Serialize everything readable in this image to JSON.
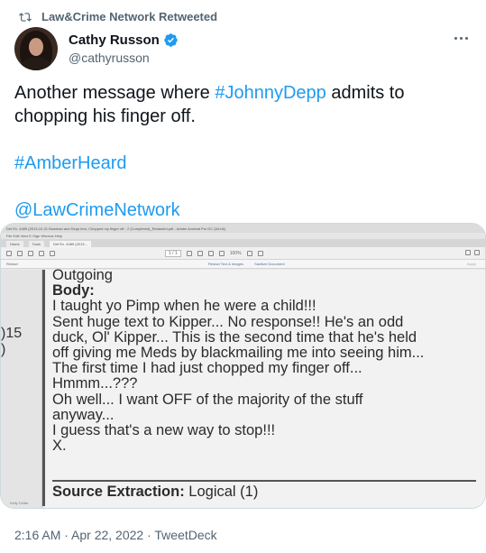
{
  "retweet": {
    "label": "Law&Crime Network Retweeted",
    "icon": "retweet-icon"
  },
  "author": {
    "display_name": "Cathy Russon",
    "handle": "@cathyrusson",
    "verified_icon": "verified-badge-icon",
    "verified_color": "#1d9bf0"
  },
  "tweet": {
    "text_before": "Another message where ",
    "hashtag_1": "#JohnnyDepp",
    "text_after": " admits to chopping his finger off.",
    "hashtag_2": "#AmberHeard",
    "mention": "@LawCrimeNetwork",
    "link_color": "#1d9bf0"
  },
  "media": {
    "window_title": "Def Ex. 4489 (2013-10-21 Bowman and Depp text- Chopped my finger off - 2 (Completed)_Redacted.pdf - Adobe Acrobat Pro DC (64-bit)",
    "menu": "File  Edit  View  E-Sign  Window  Help",
    "tabs": [
      "Home",
      "Tools",
      "Def Ex. 4489 (2013..."
    ],
    "toolbar_page": "1 / 1",
    "toolbar_zoom": "100%",
    "redact_label": "Redact",
    "redact_link_1": "Redact Text & Images",
    "redact_link_2": "Sanitize Document",
    "apply_label": "Apply",
    "gutter_text_1": ")15",
    "gutter_text_2": ")",
    "gutter_footer": "Kelly Cellar",
    "doc_lines": [
      {
        "text": "Outgoing",
        "bold": false
      },
      {
        "text": "Body:",
        "bold": true
      },
      {
        "text": "I taught yo Pimp when he were a child!!!",
        "bold": false
      },
      {
        "text": "Sent huge text to Kipper... No response!! He's an odd",
        "bold": false
      },
      {
        "text": "duck, Ol' Kipper... This is the second time that he's held",
        "bold": false
      },
      {
        "text": "off giving me Meds by blackmailing me into seeing him...",
        "bold": false
      },
      {
        "text": "The first time I had just chopped my finger off...",
        "bold": false
      },
      {
        "text": "Hmmm...???",
        "bold": false
      },
      {
        "text": "Oh well... I want OFF of the majority of the stuff",
        "bold": false
      },
      {
        "text": "anyway...",
        "bold": false
      },
      {
        "text": "I guess that's a new way to stop!!!",
        "bold": false
      },
      {
        "text": "X.",
        "bold": false
      }
    ],
    "source_label": "Source Extraction:",
    "source_value": " Logical (1)"
  },
  "timestamp": "2:16 AM · Apr 22, 2022 · TweetDeck"
}
